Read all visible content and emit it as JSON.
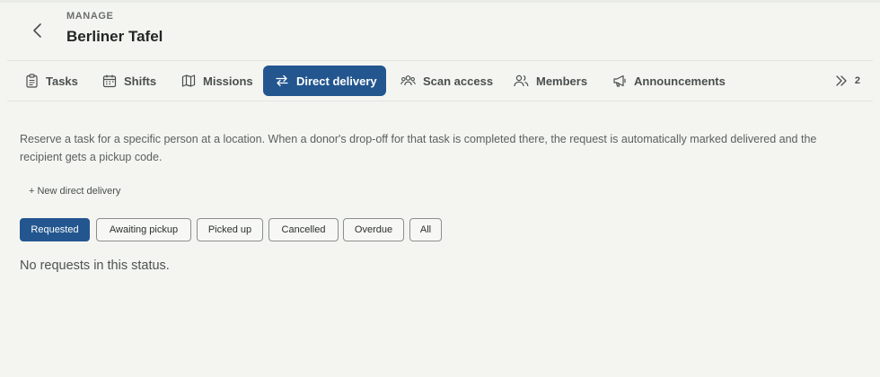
{
  "header": {
    "eyebrow": "MANAGE",
    "title": "Berliner Tafel",
    "back_icon": "chevron-left-icon"
  },
  "tabs": [
    {
      "label": "Tasks",
      "icon": "clipboard-icon",
      "active": false
    },
    {
      "label": "Shifts",
      "icon": "calendar-icon",
      "active": false
    },
    {
      "label": "Missions",
      "icon": "map-icon",
      "active": false
    },
    {
      "label": "Direct delivery",
      "icon": "arrows-swap-icon",
      "active": true
    },
    {
      "label": "Scan access",
      "icon": "group-icon",
      "active": false
    },
    {
      "label": "Members",
      "icon": "users-icon",
      "active": false
    },
    {
      "label": "Announcements",
      "icon": "megaphone-icon",
      "active": false
    }
  ],
  "more": {
    "icon": "double-chevron-right-icon",
    "count": "2"
  },
  "main": {
    "description": "Reserve a task for a specific person at a location. When a donor's drop-off for that task is completed there, the request is automatically marked delivered and the recipient gets a pickup code.",
    "new_link": "+ New direct delivery",
    "filters": [
      {
        "label": "Requested",
        "active": true
      },
      {
        "label": "Awaiting pickup",
        "active": false
      },
      {
        "label": "Picked up",
        "active": false
      },
      {
        "label": "Cancelled",
        "active": false
      },
      {
        "label": "Overdue",
        "active": false
      },
      {
        "label": "All",
        "active": false
      }
    ],
    "empty_message": "No requests in this status."
  },
  "colors": {
    "accent": "#23568f",
    "background": "#f4f5f1",
    "text": "#2b2f2e"
  }
}
